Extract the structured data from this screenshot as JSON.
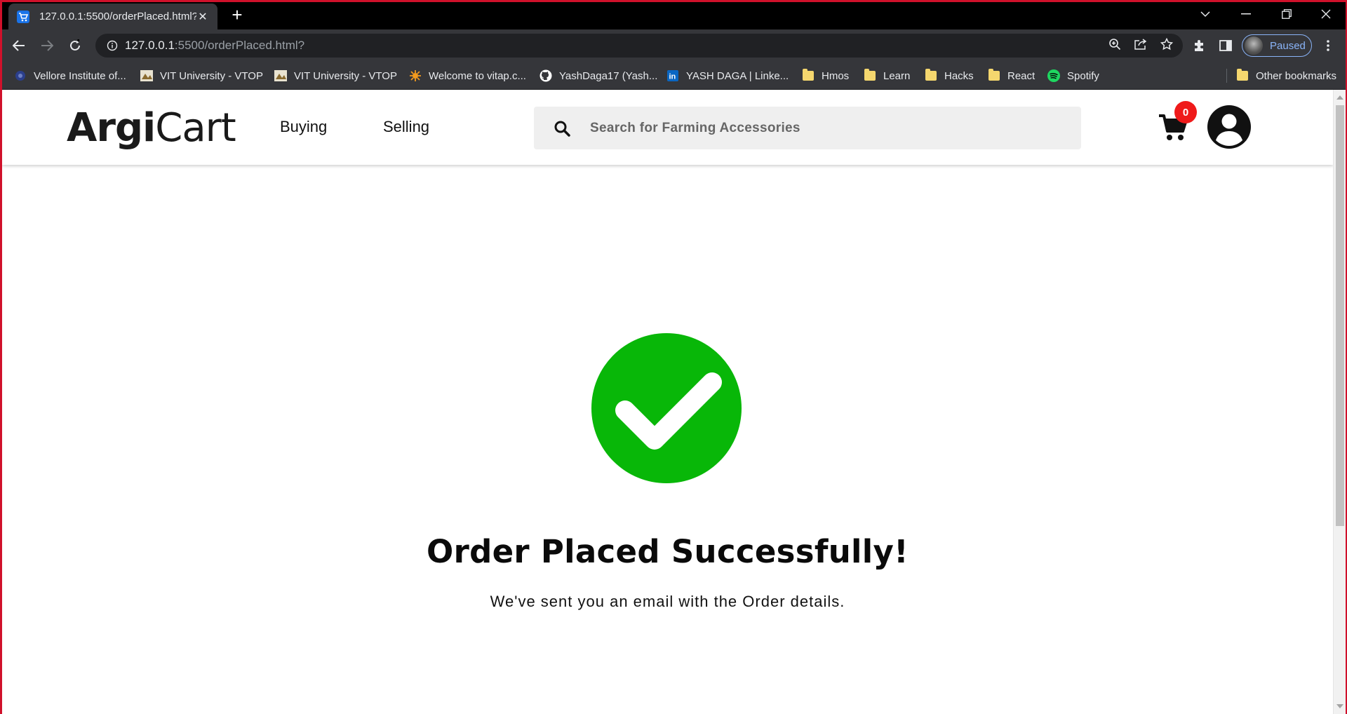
{
  "browser": {
    "tab_title": "127.0.0.1:5500/orderPlaced.html?",
    "url_host": "127.0.0.1",
    "url_rest": ":5500/orderPlaced.html?",
    "profile_label": "Paused"
  },
  "bookmarks": [
    {
      "label": "Vellore Institute of...",
      "icon": "vit-icon"
    },
    {
      "label": "VIT University - VTOP",
      "icon": "vtop-icon"
    },
    {
      "label": "VIT University - VTOP",
      "icon": "vtop-icon"
    },
    {
      "label": "Welcome to vitap.c...",
      "icon": "vitap-icon"
    },
    {
      "label": "YashDaga17 (Yash...",
      "icon": "github-icon"
    },
    {
      "label": "YASH DAGA | Linke...",
      "icon": "linkedin-icon"
    },
    {
      "label": "Hmos",
      "icon": "folder-icon"
    },
    {
      "label": "Learn",
      "icon": "folder-icon"
    },
    {
      "label": "Hacks",
      "icon": "folder-icon"
    },
    {
      "label": "React",
      "icon": "folder-icon"
    },
    {
      "label": "Spotify",
      "icon": "spotify-icon"
    }
  ],
  "other_bookmarks": "Other bookmarks",
  "site": {
    "logo_bold": "Argi",
    "logo_light": "Cart",
    "nav": [
      "Buying",
      "Selling"
    ],
    "search_placeholder": "Search for Farming Accessories",
    "cart_count": "0"
  },
  "main": {
    "headline": "Order Placed Successfully!",
    "subline": "We've sent you an email with the Order details."
  },
  "colors": {
    "success": "#08b708",
    "badge": "#ef1a1a",
    "frame": "#d0112b"
  }
}
